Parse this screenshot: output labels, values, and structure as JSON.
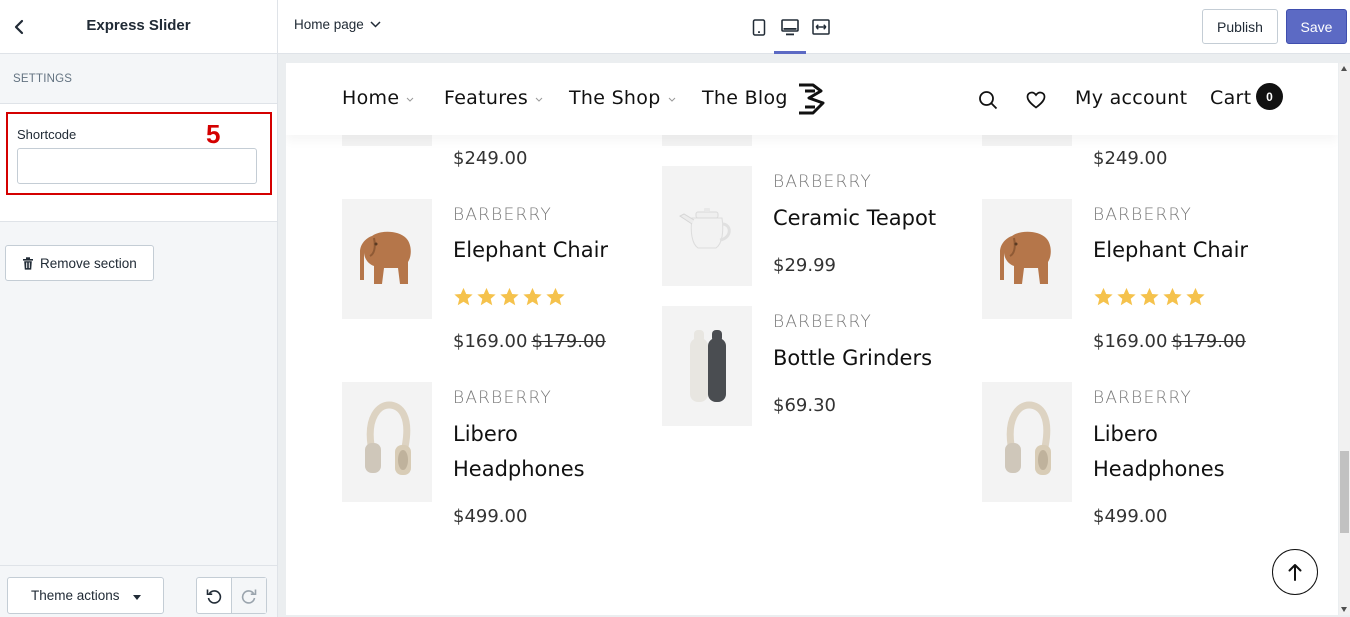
{
  "sidebar": {
    "title": "Express Slider",
    "section_label": "SETTINGS",
    "field_label": "Shortcode",
    "field_value": "",
    "marker": "5",
    "remove_label": "Remove section",
    "theme_actions_label": "Theme actions"
  },
  "topbar": {
    "page_select": "Home page",
    "publish_label": "Publish",
    "save_label": "Save"
  },
  "nav": {
    "items": [
      "Home",
      "Features",
      "The Shop",
      "The Blog"
    ],
    "account_label": "My account",
    "cart_label": "Cart",
    "cart_count": "0"
  },
  "products": {
    "top_partial_prices": [
      "$249.00",
      "$249.00"
    ],
    "items": [
      {
        "brand": "BARBERRY",
        "name": "Elephant Chair",
        "rating": 5,
        "price": "$169.00",
        "old_price": "$179.00"
      },
      {
        "brand": "BARBERRY",
        "name": "Ceramic Teapot",
        "price": "$29.99"
      },
      {
        "brand": "BARBERRY",
        "name": "Elephant Chair",
        "rating": 5,
        "price": "$169.00",
        "old_price": "$179.00"
      },
      {
        "brand": "BARBERRY",
        "name": "Libero Headphones",
        "name_line1": "Libero",
        "name_line2": "Headphones",
        "price": "$499.00"
      },
      {
        "brand": "BARBERRY",
        "name": "Bottle Grinders",
        "price": "$69.30"
      },
      {
        "brand": "BARBERRY",
        "name": "Libero Headphones",
        "name_line1": "Libero",
        "name_line2": "Headphones",
        "price": "$499.00"
      }
    ]
  },
  "colors": {
    "accent": "#5c6ac4",
    "highlight": "#d40000",
    "star": "#f5c24c"
  }
}
